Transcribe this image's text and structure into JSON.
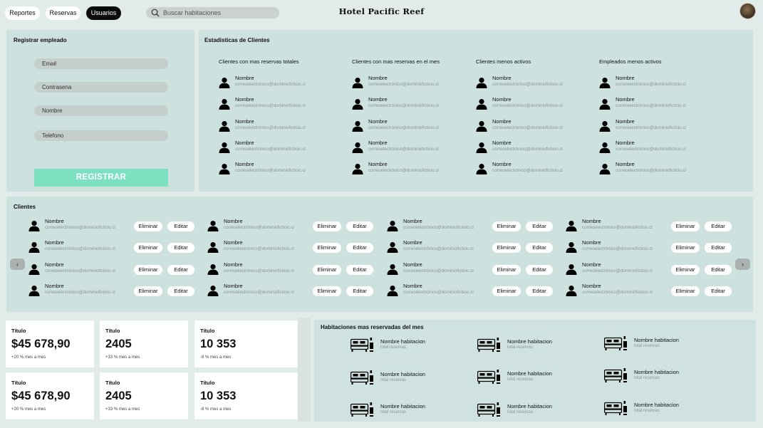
{
  "nav": {
    "tabs": [
      "Reportes",
      "Reservas",
      "Usuarios"
    ],
    "active": "Usuarios"
  },
  "search": {
    "placeholder": "Buscar habitaciones"
  },
  "brand": "Hotel Pacific Reef",
  "register": {
    "title": "Registrar empleado",
    "fields": [
      "Email",
      "Contrasena",
      "Nombre",
      "Telefono"
    ],
    "button": "REGISTRAR"
  },
  "stats": {
    "title": "Estadisticas de Clientes",
    "columns": [
      {
        "title": "Clientes con mas reservas totales"
      },
      {
        "title": "Clientes con mas reservas en el mes"
      },
      {
        "title": "Clientes menos activos"
      },
      {
        "title": "Empleados menos activos"
      }
    ],
    "person": {
      "name": "Nombre",
      "email": "correoelectrónico@dominioficticio.cl"
    }
  },
  "clients": {
    "title": "Clientes",
    "delete_label": "Eliminar",
    "edit_label": "Editar",
    "prev": "‹",
    "next": "›"
  },
  "cards": [
    {
      "title": "Título",
      "value": "$45 678,90",
      "sub": "+20 % mes a mes"
    },
    {
      "title": "Título",
      "value": "2405",
      "sub": "+33 % mes a mes"
    },
    {
      "title": "Título",
      "value": "10 353",
      "sub": "-8 % mes a mes"
    },
    {
      "title": "Título",
      "value": "$45 678,90",
      "sub": "+20 % mes a mes"
    },
    {
      "title": "Título",
      "value": "2405",
      "sub": "+33 % mes a mes"
    },
    {
      "title": "Título",
      "value": "10 353",
      "sub": "-8 % mes a mes"
    }
  ],
  "rooms": {
    "title": "Habitaciones mas reservadas del mes",
    "item": {
      "name": "Nombre habitacion",
      "sub": "total reservas"
    }
  }
}
